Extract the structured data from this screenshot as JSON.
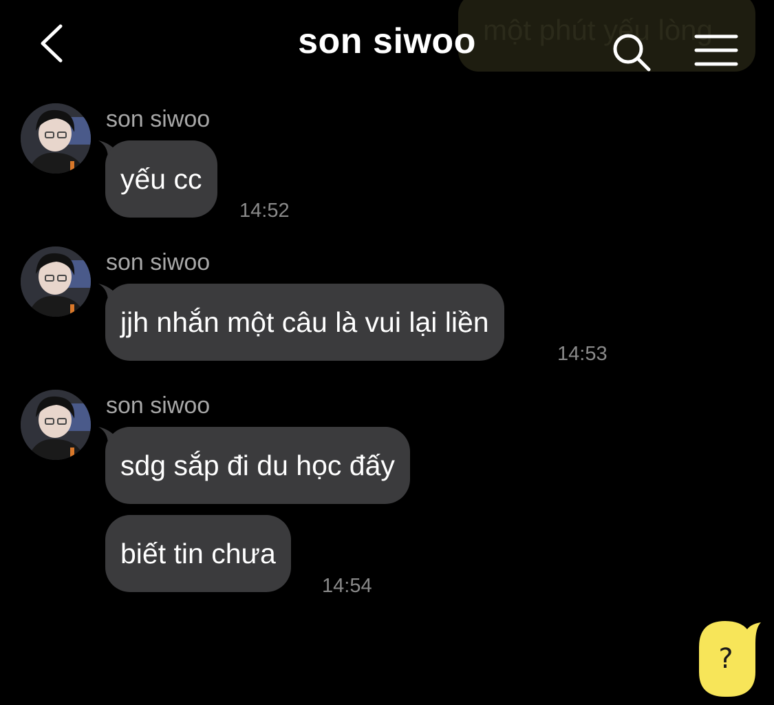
{
  "header": {
    "title": "son siwoo",
    "back_icon": "chevron-left-icon",
    "search_icon": "search-icon",
    "menu_icon": "hamburger-menu-icon"
  },
  "background_bubble": {
    "text": "một phút yếu lòng"
  },
  "messages": [
    {
      "sender": "son siwoo",
      "bubbles": [
        "yếu cc"
      ],
      "time": "14:52"
    },
    {
      "sender": "son siwoo",
      "bubbles": [
        "jjh nhắn một câu là vui lại liền"
      ],
      "time": "14:53"
    },
    {
      "sender": "son siwoo",
      "bubbles": [
        "sdg sắp đi du học đấy",
        "biết tin chưa"
      ],
      "time": "14:54"
    }
  ],
  "fab": {
    "label": "?",
    "icon": "speech-bubble-icon"
  },
  "colors": {
    "background": "#000000",
    "bubble": "#3b3b3d",
    "sender_text": "#a8a8a8",
    "time_text": "#8a8a8a",
    "accent_yellow": "#f7e559"
  }
}
